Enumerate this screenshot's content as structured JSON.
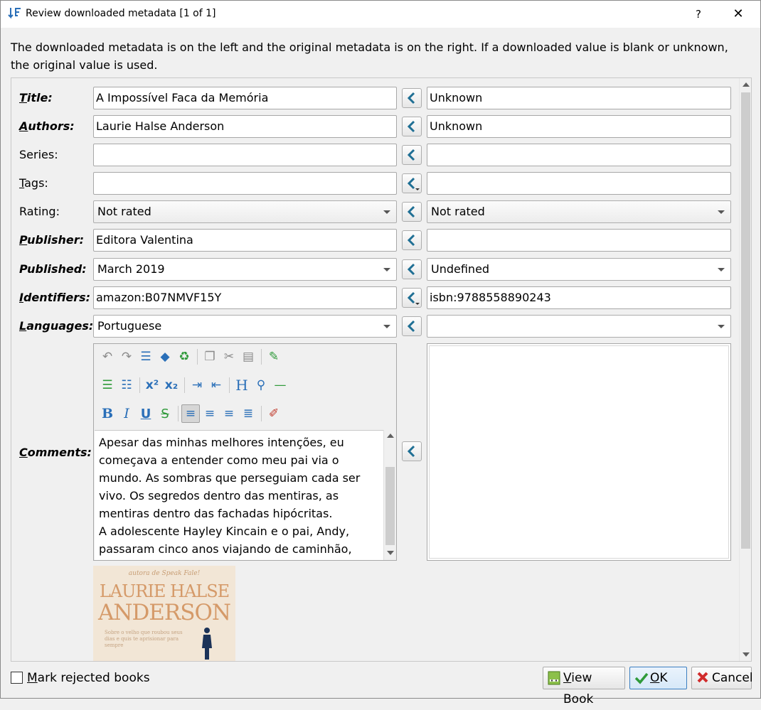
{
  "window": {
    "title": "Review downloaded metadata [1 of 1]",
    "help": "?",
    "close": "✕"
  },
  "description": "The downloaded metadata is on the left and the original metadata is on the right. If a downloaded value is blank or unknown, the original value is used.",
  "fields": [
    {
      "key": "title",
      "label": "Title:",
      "u": "T",
      "rest": "itle:",
      "bold": true,
      "left": "A Impossível Faca da Memória",
      "right": "Unknown"
    },
    {
      "key": "authors",
      "label": "Authors:",
      "u": "A",
      "rest": "uthors:",
      "bold": true,
      "left": "Laurie Halse Anderson",
      "right": "Unknown"
    },
    {
      "key": "series",
      "label": "Series:",
      "u": "",
      "rest": "Series:",
      "bold": false,
      "left": "",
      "right": ""
    },
    {
      "key": "tags",
      "label": "Tags:",
      "u": "T",
      "rest": "ags:",
      "bold": false,
      "left": "",
      "right": ""
    },
    {
      "key": "rating",
      "label": "Rating:",
      "u": "",
      "rest": "Rating:",
      "bold": false,
      "left": "Not rated",
      "right": "Not rated"
    },
    {
      "key": "publisher",
      "label": "Publisher:",
      "u": "P",
      "rest": "ublisher:",
      "bold": true,
      "left": "Editora Valentina",
      "right": ""
    },
    {
      "key": "published",
      "label": "Published:",
      "u": "",
      "rest": "Published:",
      "bold": true,
      "left": "March 2019",
      "right": "Undefined"
    },
    {
      "key": "identifiers",
      "label": "Identifiers:",
      "u": "I",
      "rest": "dentifiers:",
      "bold": true,
      "left": "amazon:B07NMVF15Y",
      "right": "isbn:9788558890243"
    },
    {
      "key": "languages",
      "label": "Languages:",
      "u": "L",
      "rest": "anguages:",
      "bold": true,
      "left": "Portuguese",
      "right": ""
    }
  ],
  "comments": {
    "label_u": "C",
    "label_rest": "omments:",
    "text": "Apesar das minhas melhores intenções, eu começava a entender como meu pai via o mundo. As sombras que perseguiam cada ser vivo. Os segredos dentro das mentiras, as mentiras dentro das fachadas hipócritas.\nA adolescente Hayley Kincain e o pai, Andy, passaram cinco anos viajando de caminhão,"
  },
  "toolbar": {
    "superscript": "x²",
    "subscript": "x₂",
    "heading": "H",
    "bold": "B",
    "italic": "I",
    "underline": "U",
    "strike": "S"
  },
  "cover": {
    "line1": "autora de Speak Fale!",
    "line2": "LAURIE HALSE",
    "line3": "ANDERSON",
    "blurb": "Sobre o velho que roubou seus dias e quis te aprisionar para sempre"
  },
  "bottom": {
    "mark_rejected_u": "M",
    "mark_rejected_rest": "ark rejected books",
    "view_book_u": "V",
    "view_book_rest": "iew Book",
    "ok_u": "O",
    "ok_rest": "K",
    "cancel": "Cancel"
  },
  "colors": {
    "accent": "#2a6fb8",
    "ok_green": "#2f9a3a",
    "cancel_red": "#d12b2b",
    "arrow_teal": "#1f6f94"
  }
}
